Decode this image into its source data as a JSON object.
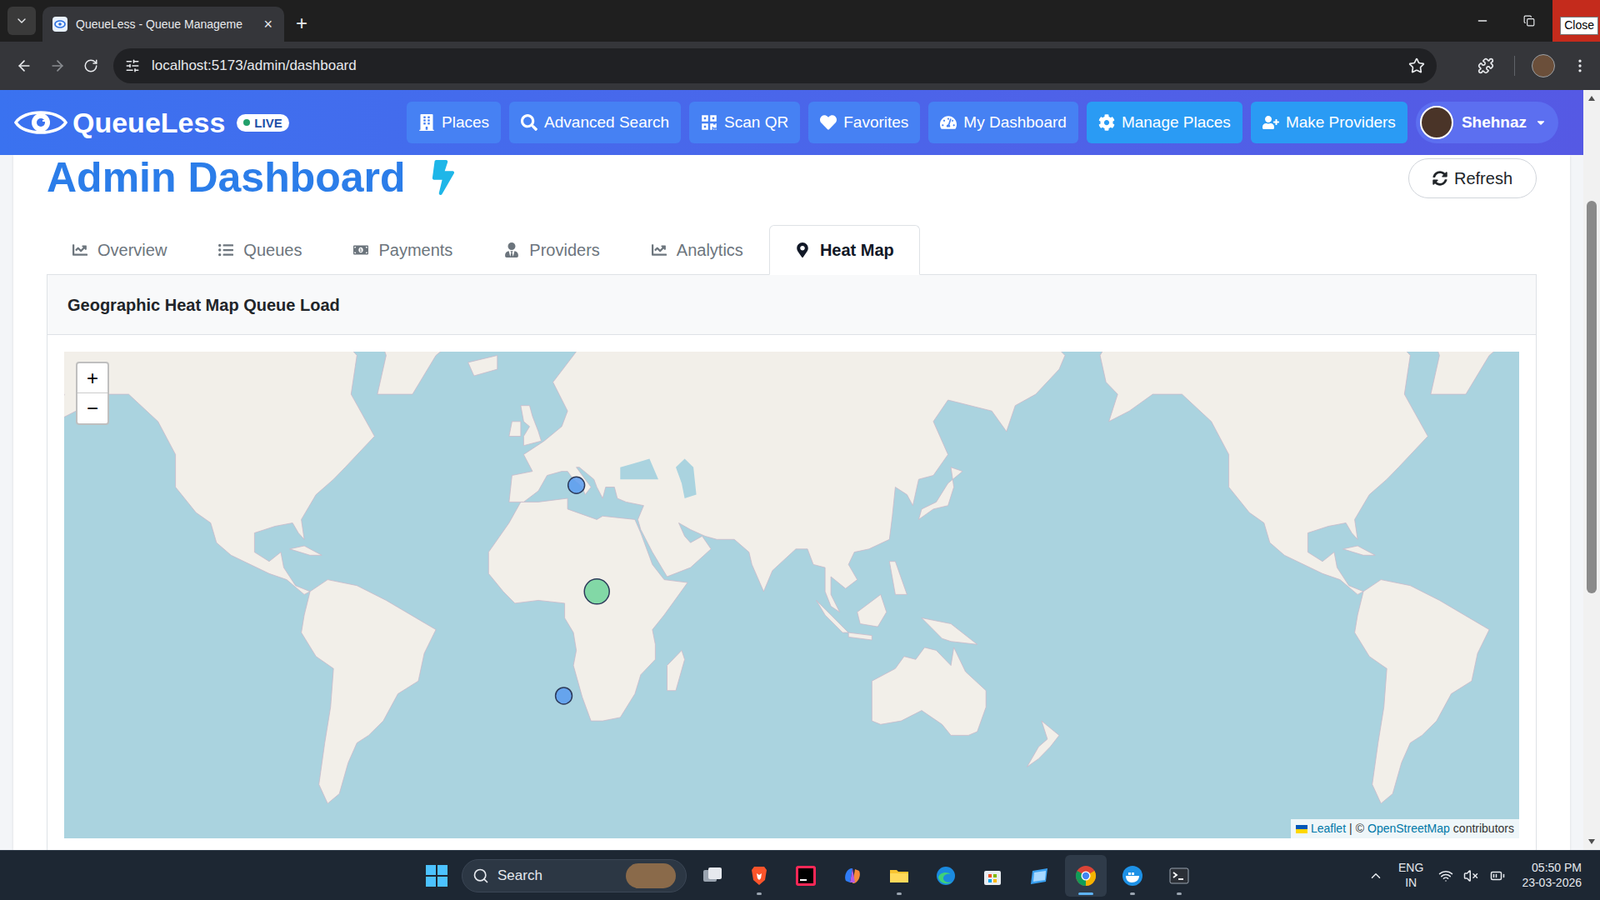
{
  "browser": {
    "tab": {
      "title": "QueueLess - Queue Manageme",
      "close": "×"
    },
    "new_tab": "+",
    "close_tooltip": "Close",
    "url": "localhost:5173/admin/dashboard"
  },
  "navbar": {
    "brand": "QueueLess",
    "badge": "LIVE",
    "items": [
      {
        "label": "Places",
        "kind": "places",
        "highlighted": false
      },
      {
        "label": "Advanced Search",
        "kind": "search",
        "highlighted": false
      },
      {
        "label": "Scan QR",
        "kind": "qr",
        "highlighted": false
      },
      {
        "label": "Favorites",
        "kind": "favorites",
        "highlighted": false
      },
      {
        "label": "My Dashboard",
        "kind": "dashboard",
        "highlighted": false
      },
      {
        "label": "Manage Places",
        "kind": "manage",
        "highlighted": true
      },
      {
        "label": "Make Providers",
        "kind": "providers",
        "highlighted": true
      }
    ],
    "user": "Shehnaz"
  },
  "page": {
    "title": "Admin Dashboard",
    "refresh": "Refresh",
    "tabs": [
      {
        "label": "Overview",
        "kind": "overview",
        "selected": false
      },
      {
        "label": "Queues",
        "kind": "queues",
        "selected": false
      },
      {
        "label": "Payments",
        "kind": "payments",
        "selected": false
      },
      {
        "label": "Providers",
        "kind": "providers",
        "selected": false
      },
      {
        "label": "Analytics",
        "kind": "analytics",
        "selected": false
      },
      {
        "label": "Heat Map",
        "kind": "heatmap",
        "selected": true
      }
    ],
    "card_title": "Geographic Heat Map Queue Load"
  },
  "map": {
    "zoom_in": "+",
    "zoom_out": "−",
    "markers": [
      {
        "lat": 40.5,
        "lng": 13,
        "level": 0.33,
        "color": "#5b9bf0"
      },
      {
        "lat": 8,
        "lng": 20,
        "level": 0.75,
        "color": "#6fd49a"
      },
      {
        "lat": -26.6,
        "lng": 8.7,
        "level": 0.33,
        "color": "#5b9bf0"
      }
    ],
    "attribution": {
      "leaflet": "Leaflet",
      "separator": "|",
      "copyright": "©",
      "osm": "OpenStreetMap",
      "suffix": "contributors"
    }
  },
  "scroll": {
    "position": 0.13,
    "thumb": 0.54
  },
  "taskbar": {
    "search": "Search",
    "apps": [
      {
        "kind": "taskview",
        "running": false,
        "selected": false
      },
      {
        "kind": "brave",
        "running": true,
        "selected": false
      },
      {
        "kind": "intellij",
        "running": false,
        "selected": false
      },
      {
        "kind": "copilot",
        "running": false,
        "selected": false
      },
      {
        "kind": "explorer",
        "running": true,
        "selected": false
      },
      {
        "kind": "edge",
        "running": false,
        "selected": false
      },
      {
        "kind": "store",
        "running": false,
        "selected": false
      },
      {
        "kind": "tablet",
        "running": false,
        "selected": false
      },
      {
        "kind": "chrome",
        "running": true,
        "selected": true
      },
      {
        "kind": "docker",
        "running": true,
        "selected": false
      },
      {
        "kind": "terminal",
        "running": true,
        "selected": false
      }
    ],
    "language": "ENG",
    "region": "IN",
    "time": "05:50 PM",
    "date": "23-03-2026"
  }
}
